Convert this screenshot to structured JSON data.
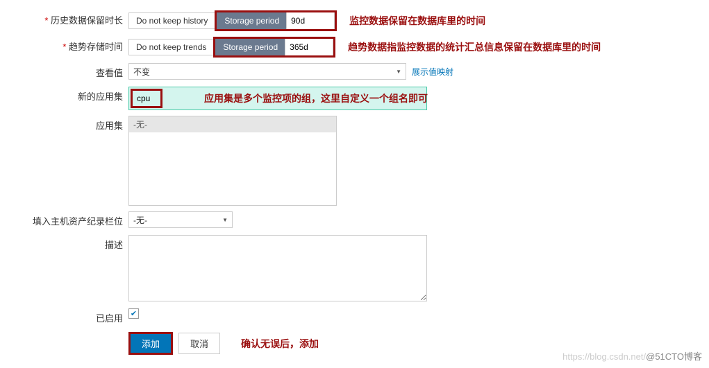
{
  "rows": {
    "history": {
      "label": "历史数据保留时长",
      "opt1": "Do not keep history",
      "opt2": "Storage period",
      "value": "90d",
      "annotation": "监控数据保留在数据库里的时间"
    },
    "trends": {
      "label": "趋势存储时间",
      "opt1": "Do not keep trends",
      "opt2": "Storage period",
      "value": "365d",
      "annotation": "趋势数据指监控数据的统计汇总信息保留在数据库里的时间"
    },
    "view_value": {
      "label": "查看值",
      "selected": "不变",
      "link": "展示值映射"
    },
    "new_app": {
      "label": "新的应用集",
      "value": "cpu",
      "annotation": "应用集是多个监控项的组，这里自定义一个组名即可"
    },
    "app_set": {
      "label": "应用集",
      "item": "-无-"
    },
    "host_inventory": {
      "label": "填入主机资产纪录栏位",
      "selected": "-无-"
    },
    "description": {
      "label": "描述",
      "value": ""
    },
    "enabled": {
      "label": "已启用",
      "checked": "✔"
    }
  },
  "buttons": {
    "submit": "添加",
    "cancel": "取消",
    "submit_annotation": "确认无误后，添加"
  },
  "watermark": {
    "light": "https://blog.csdn.net/",
    "dark": "@51CTO博客"
  }
}
